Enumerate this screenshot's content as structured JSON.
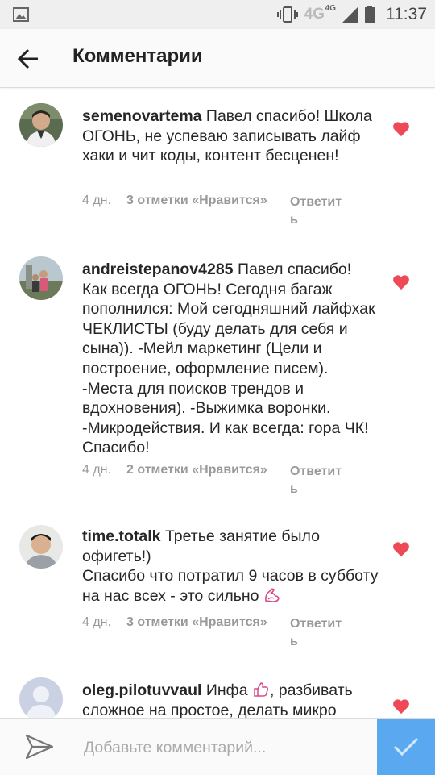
{
  "status_bar": {
    "network": "4G",
    "network_small": "4G",
    "time": "11:37",
    "icons": [
      "gallery-icon",
      "vibrate-icon",
      "signal-icon",
      "battery-icon"
    ]
  },
  "header": {
    "title": "Комментарии",
    "back_icon": "arrow-left-icon"
  },
  "comments": [
    {
      "username": "semenovartema",
      "text": "Павел спасибо! Школа ОГОНЬ, не успеваю записывать лайф хаки и чит коды, контент бесценен!",
      "time": "4 дн.",
      "likes": "3 отметки «Нравится»",
      "reply": "Ответить"
    },
    {
      "username": "andreistepanov4285",
      "text": "Павел спасибо! Как всегда ОГОНЬ! Сегодня багаж пополнился: Мой сегодняшний лайфхак ЧЕКЛИСТЫ (буду делать для себя и сына)). -Мейл маркетинг (Цели и построение, оформление писем). -Места для поисков трендов и вдохновения). -Выжимка воронки. -Микродействия. И как всегда: гора ЧК! Спасибо!",
      "time": "4 дн.",
      "likes": "2 отметки «Нравится»",
      "reply": "Ответить"
    },
    {
      "username": "time.totalk",
      "text": "Третье занятие было офигеть!)",
      "text2": "Спасибо что потратил 9 часов в субботу на нас всех - это сильно",
      "emoji": "flexed-biceps-emoji",
      "time": "4 дн.",
      "likes": "3 отметки «Нравится»",
      "reply": "Ответить"
    },
    {
      "username": "oleg.pilotuvvaul",
      "text_before_emoji": "Инфа",
      "emoji": "thumbs-up-emoji",
      "text_after_emoji": ", разбивать сложное на простое, делать микро"
    }
  ],
  "composer": {
    "placeholder": "Добавьте комментарий...",
    "send_icon": "paper-plane-icon",
    "submit_icon": "checkmark-icon"
  },
  "colors": {
    "heart": "#ed4956",
    "submit": "#5aa9f0",
    "meta": "#999999"
  }
}
